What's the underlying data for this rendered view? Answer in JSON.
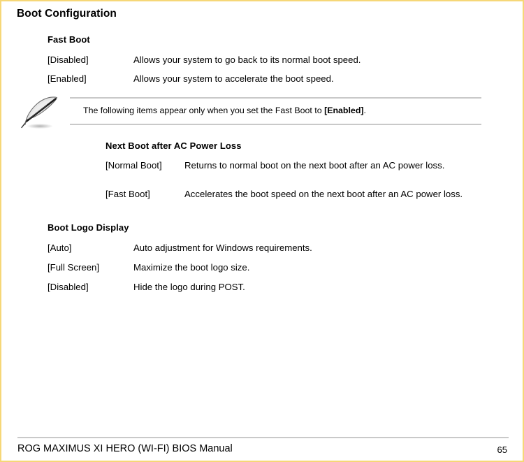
{
  "page": {
    "title": "Boot Configuration",
    "border_color": "#f6d777",
    "rule_color": "#c9c9c9"
  },
  "sections": [
    {
      "heading": "Fast Boot",
      "options": [
        {
          "key": "[Disabled]",
          "desc": "Allows your system to go back to its normal boot speed."
        },
        {
          "key": "[Enabled]",
          "desc": "Allows your system to accelerate the boot speed."
        }
      ]
    },
    {
      "heading": "Boot Logo Display",
      "options": [
        {
          "key": "[Auto]",
          "desc": "Auto adjustment for Windows requirements."
        },
        {
          "key": "[Full Screen]",
          "desc": "Maximize the boot logo size."
        },
        {
          "key": "[Disabled]",
          "desc": "Hide the logo during POST."
        }
      ]
    }
  ],
  "note": {
    "icon": "note-pencil-icon",
    "text_prefix": "The following items appear only when you set the Fast Boot to ",
    "text_bold": "[Enabled]",
    "text_suffix": "."
  },
  "subsection": {
    "heading": "Next Boot after AC Power Loss",
    "options": [
      {
        "key": "[Normal Boot]",
        "desc": "Returns to normal boot on the next boot after an AC power loss."
      },
      {
        "key": "[Fast Boot]",
        "desc": "Accelerates the boot speed on the next boot after an AC power loss."
      }
    ]
  },
  "footer": {
    "manual_title": "ROG MAXIMUS XI HERO (WI-FI) BIOS Manual",
    "page_number": "65"
  }
}
